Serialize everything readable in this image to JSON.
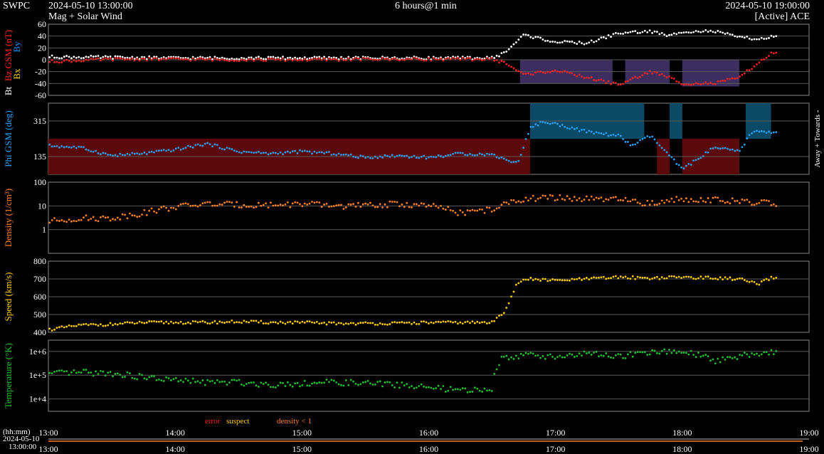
{
  "header": {
    "org": "SWPC",
    "start_time": "2024-05-10 13:00:00",
    "subtitle": "Mag + Solar Wind",
    "span": "6 hours@1 min",
    "end_time": "2024-05-10 19:00:00",
    "source": "[Active] ACE"
  },
  "legend": {
    "error": "error",
    "suspect": "suspect",
    "density_low": "density < 1"
  },
  "bottom": {
    "unit_label": "(hh:mm)",
    "date_label": "2024-05-10",
    "time_label": "13:00:00"
  },
  "colors": {
    "bt": "#ffffff",
    "bz": "#ff2020",
    "bx": "#ffd700",
    "by": "#1e90ff",
    "phi": "#2a9df4",
    "density": "#ff7f24",
    "speed": "#ffcc00",
    "temperature": "#1fbf2f",
    "phi_away_fill": "#5a0a0a",
    "phi_towards_fill": "#0a4a66",
    "bz_south_fill": "#3c2e5e",
    "grid": "#5a5a5a"
  },
  "chart_data": [
    {
      "type": "scatter",
      "panel": "mag",
      "ylabel_parts": [
        "Bz GSM (nT)",
        "Bx",
        "By",
        "Bt"
      ],
      "ylim": [
        -60,
        60
      ],
      "yticks": [
        "60",
        "40",
        "20",
        "0",
        "-20",
        "-40",
        "-60"
      ],
      "x_hours": [
        13,
        13.5,
        14,
        14.5,
        15,
        15.5,
        16,
        16.5,
        16.6,
        16.75,
        17,
        17.25,
        17.5,
        17.75,
        17.9,
        18,
        18.25,
        18.45,
        18.6,
        18.7
      ],
      "series": [
        {
          "name": "Bt",
          "values": [
            5,
            4,
            3,
            3,
            3,
            3,
            3,
            3,
            12,
            42,
            30,
            28,
            45,
            48,
            40,
            48,
            48,
            38,
            35,
            38
          ]
        },
        {
          "name": "Bz",
          "values": [
            -3,
            1,
            1,
            0,
            0,
            1,
            1,
            1,
            -5,
            -25,
            -18,
            -30,
            -42,
            -20,
            -30,
            -40,
            -40,
            -30,
            -5,
            10
          ]
        }
      ]
    },
    {
      "type": "scatter",
      "panel": "phi",
      "ylabel": "Phi GSM (deg)",
      "side_label": "Away + Towards -",
      "ylim": [
        45,
        405
      ],
      "yticks": [
        "315",
        "135"
      ],
      "x_hours": [
        13,
        13.25,
        13.5,
        13.75,
        14,
        14.25,
        14.5,
        14.75,
        15,
        15.25,
        15.5,
        15.75,
        16,
        16.25,
        16.5,
        16.7,
        16.8,
        16.9,
        17,
        17.25,
        17.5,
        17.6,
        17.75,
        18,
        18.25,
        18.45,
        18.55,
        18.7
      ],
      "values": [
        190,
        180,
        140,
        150,
        170,
        200,
        160,
        150,
        160,
        150,
        130,
        140,
        130,
        150,
        145,
        100,
        280,
        310,
        300,
        260,
        240,
        190,
        240,
        70,
        180,
        160,
        260,
        260
      ]
    },
    {
      "type": "scatter",
      "panel": "density",
      "ylabel": "Density (1/cm³)",
      "yscale": "log",
      "ylim": [
        0.1,
        100
      ],
      "yticks": [
        "100",
        "10",
        "1"
      ],
      "x_hours": [
        13,
        13.25,
        13.5,
        13.75,
        14,
        14.25,
        14.5,
        14.75,
        15,
        15.25,
        15.5,
        15.75,
        16,
        16.25,
        16.5,
        16.6,
        16.75,
        17,
        17.25,
        17.5,
        17.75,
        18,
        18.25,
        18.5,
        18.7
      ],
      "values": [
        2.2,
        3,
        3,
        5,
        9,
        12,
        11,
        11,
        12,
        10,
        10,
        12,
        10,
        5,
        7,
        11,
        20,
        22,
        19,
        18,
        12,
        20,
        18,
        14,
        13
      ]
    },
    {
      "type": "scatter",
      "panel": "speed",
      "ylabel": "Speed (km/s)",
      "ylim": [
        400,
        800
      ],
      "yticks": [
        "800",
        "700",
        "600",
        "500",
        "400"
      ],
      "x_hours": [
        13,
        13.25,
        13.5,
        13.75,
        14,
        14.25,
        14.5,
        14.75,
        15,
        15.25,
        15.5,
        15.75,
        16,
        16.25,
        16.5,
        16.6,
        16.7,
        16.8,
        17,
        17.25,
        17.5,
        17.75,
        18,
        18.25,
        18.45,
        18.6,
        18.7
      ],
      "values": [
        415,
        440,
        445,
        455,
        455,
        455,
        460,
        455,
        455,
        450,
        450,
        450,
        455,
        455,
        455,
        520,
        680,
        700,
        690,
        700,
        710,
        705,
        710,
        705,
        700,
        670,
        705
      ]
    },
    {
      "type": "scatter",
      "panel": "temperature",
      "ylabel": "Temperature (°K)",
      "yscale": "log",
      "ylim": [
        3000,
        3000000
      ],
      "yticks": [
        "1e+6",
        "1e+5",
        "1e+4"
      ],
      "x_hours": [
        13,
        13.25,
        13.5,
        13.75,
        14,
        14.25,
        14.5,
        14.75,
        15,
        15.25,
        15.5,
        15.75,
        16,
        16.25,
        16.5,
        16.6,
        16.75,
        17,
        17.25,
        17.5,
        17.75,
        18,
        18.25,
        18.5,
        18.7
      ],
      "values": [
        110000,
        130000,
        120000,
        80000,
        60000,
        50000,
        50000,
        40000,
        45000,
        50000,
        45000,
        40000,
        30000,
        22000,
        25000,
        600000,
        700000,
        600000,
        800000,
        600000,
        900000,
        1000000,
        400000,
        700000,
        900000
      ]
    }
  ],
  "time_axis": {
    "labels": [
      "13:00",
      "14:00",
      "15:00",
      "16:00",
      "17:00",
      "18:00",
      "19:00"
    ]
  }
}
